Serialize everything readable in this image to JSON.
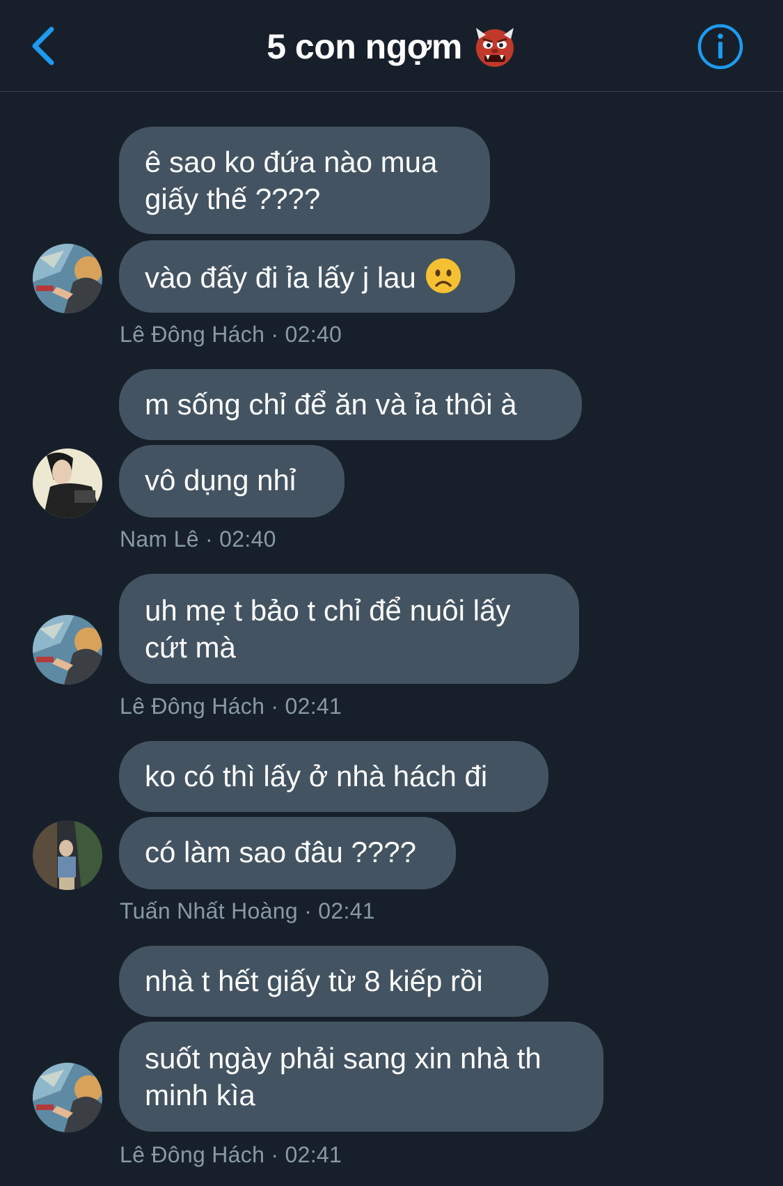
{
  "header": {
    "title": "5 con ngợm",
    "title_emoji": "ogre-emoji",
    "back_icon": "chevron-left-icon",
    "info_icon": "info-circle-icon"
  },
  "colors": {
    "background": "#17202a",
    "bubble": "#435361",
    "accent": "#1d9bf0",
    "meta_text": "#8899a6"
  },
  "messages": [
    {
      "sender": "Lê Đông Hách",
      "time": "02:40",
      "avatar": "avatar-hach",
      "bubbles": [
        "ê sao ko đứa nào mua\ngiấy thế ????",
        "vào đấy đi ỉa lấy j lau"
      ],
      "meta": "Lê Đông Hách · 02:40"
    },
    {
      "sender": "Nam Lê",
      "time": "02:40",
      "avatar": "avatar-nam",
      "bubbles": [
        "m sống chỉ để ăn và ỉa thôi à",
        "vô dụng nhỉ"
      ],
      "meta": "Nam Lê · 02:40"
    },
    {
      "sender": "Lê Đông Hách",
      "time": "02:41",
      "avatar": "avatar-hach",
      "bubbles": [
        "uh mẹ t bảo t chỉ để nuôi lấy\ncứt mà"
      ],
      "meta": "Lê Đông Hách · 02:41"
    },
    {
      "sender": "Tuấn Nhất Hoàng",
      "time": "02:41",
      "avatar": "avatar-tuan",
      "bubbles": [
        "ko có thì lấy ở nhà hách đi",
        "có làm sao đâu ????"
      ],
      "meta": "Tuấn Nhất Hoàng · 02:41"
    },
    {
      "sender": "Lê Đông Hách",
      "time": "02:41",
      "avatar": "avatar-hach",
      "bubbles": [
        "nhà t hết giấy từ 8 kiếp rồi",
        "suốt ngày phải sang xin nhà th\nminh kìa"
      ],
      "meta": "Lê Đông Hách · 02:41"
    }
  ],
  "inline_emoji": "frowning-face-emoji"
}
